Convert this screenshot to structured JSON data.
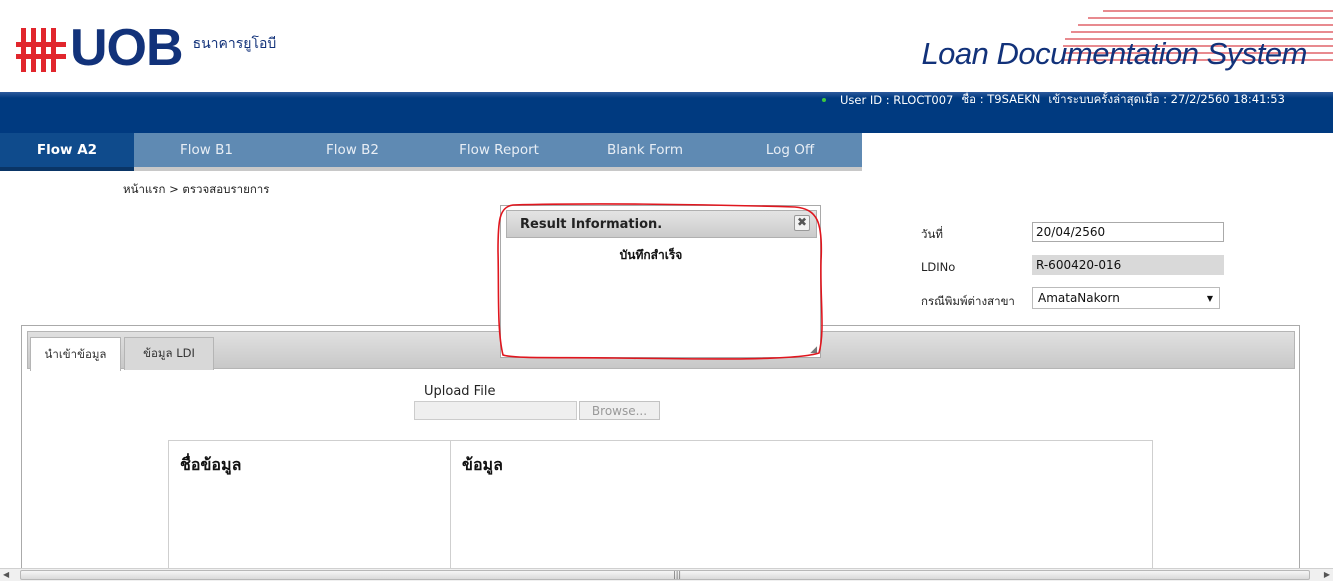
{
  "header": {
    "logo_text": "UOB",
    "logo_thai": "ธนาคารยูโอบี",
    "app_title": "Loan Documentation System"
  },
  "userbar": {
    "user_id": "User ID : RLOCT007",
    "name": "ชื่อ : T9SAEKN",
    "last_login": "เข้าระบบครั้งล่าสุดเมื่อ : 27/2/2560 18:41:53"
  },
  "nav": {
    "items": [
      "Flow A2",
      "Flow B1",
      "Flow B2",
      "Flow Report",
      "Blank Form",
      "Log Off"
    ],
    "active": "Flow A2"
  },
  "breadcrumb": "หน้าแรก > ตรวจสอบรายการ",
  "form": {
    "date_label": "วันที่",
    "date_value": "20/04/2560",
    "ldino_label": "LDINo",
    "ldino_value": "R-600420-016",
    "branch_label": "กรณีพิมพ์ต่างสาขา",
    "branch_value": "AmataNakorn"
  },
  "tabs": [
    "นำเข้าข้อมูล",
    "ข้อมูล  LDI"
  ],
  "upload": {
    "label": "Upload File",
    "browse": "Browse..."
  },
  "table": {
    "headers": [
      "ชื่อข้อมูล",
      "ข้อมูล"
    ]
  },
  "dialog": {
    "title": "Result Information.",
    "message": "บันทึกสำเร็จ",
    "close": "✖"
  },
  "colors": {
    "brand_blue": "#12327a",
    "brand_red": "#e1262d",
    "bar_blue": "#003a80",
    "nav_blue": "#5f8ab3",
    "highlight_red": "#e0161e"
  }
}
